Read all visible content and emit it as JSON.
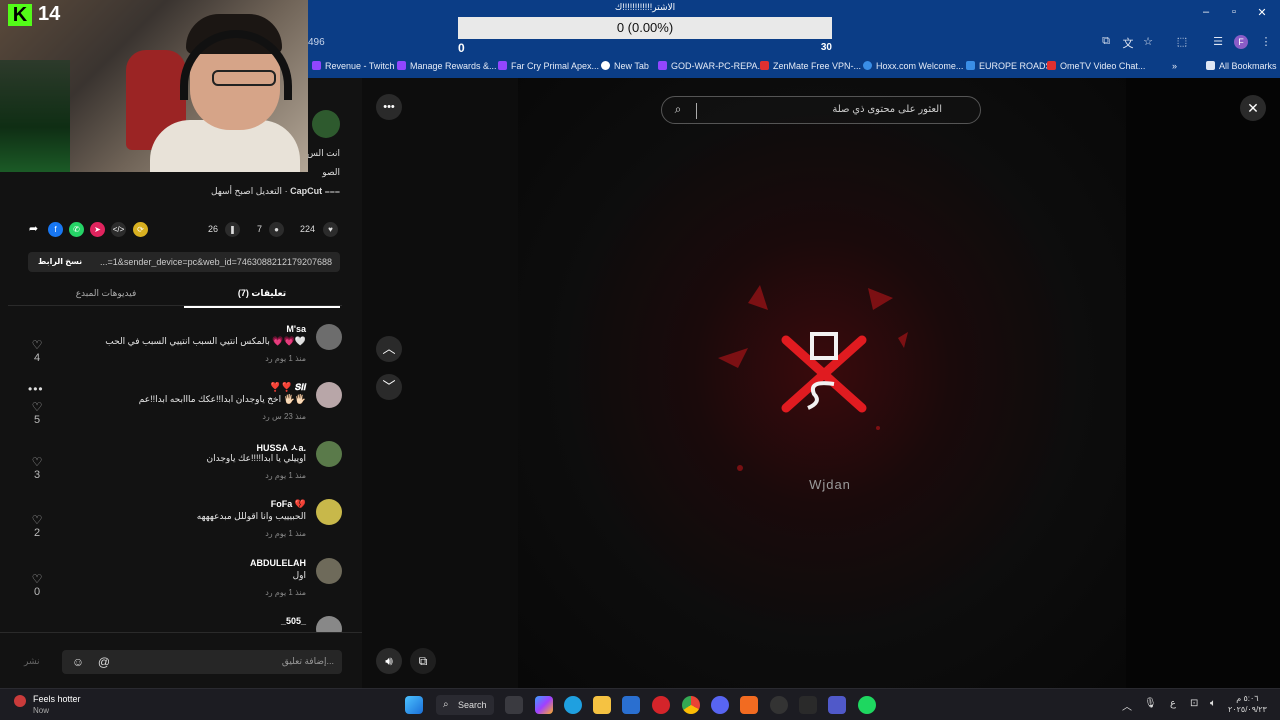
{
  "browser": {
    "url_fragment": "496",
    "window_controls": [
      "–",
      "▫",
      "✕"
    ],
    "bookmarks": [
      {
        "label": "Revenue - Twitch",
        "color": "#9146ff"
      },
      {
        "label": "Manage Rewards &...",
        "color": "#9146ff"
      },
      {
        "label": "Far Cry Primal Apex...",
        "color": "#9146ff"
      },
      {
        "label": "New Tab",
        "color": "#ffffff"
      },
      {
        "label": "GOD-WAR-PC-REPA...",
        "color": "#9146ff"
      },
      {
        "label": "ZenMate Free VPN-...",
        "color": "#e03030"
      },
      {
        "label": "Hoxx.com Welcome...",
        "color": "#3a8ee6"
      },
      {
        "label": "EUROPE ROADS",
        "color": "#3a8ee6"
      },
      {
        "label": "OmeTV Video Chat...",
        "color": "#e03030"
      },
      {
        "label": "All Bookmarks",
        "color": "#dfe6f3"
      }
    ],
    "profile_letter": "F"
  },
  "donation_goal": {
    "title": "الاشتر!!!!!!!!!!!!ك",
    "progress_text": "0 (0.00%)",
    "min": "0",
    "max": "30",
    "progress": 0
  },
  "stream_overlay": {
    "badge": "K",
    "count": "14"
  },
  "post": {
    "desc_line1": "انت الس",
    "desc_line2": "الصو",
    "capcut_label": "CapCut",
    "capcut_text": "التعديل اصبح أسهل ·",
    "likes": "224",
    "comments": "7",
    "saves": "26",
    "link_url": "...=1&sender_device=pc&web_id=7463088212179207688",
    "copy_link": "نسخ الرابط",
    "tab_comments": "(7) تعليقات",
    "tab_creator": "فيديوهات المبدع"
  },
  "comments": [
    {
      "user": "M'sa",
      "text": "بالمكس انتيي السبب انتييي السبب في الحب 💗💗🤍",
      "meta": "منذ 1 يوم    رد",
      "likes": "4",
      "avatar": "#6d6d6d"
    },
    {
      "user": "❣️❣️ 𝑺𝒊𝒊",
      "text": "اخخ ياوجدان ابدا!!عكك مااابحه ابدا!!عم 🖐🏻🖐🏻",
      "meta": "منذ 23 س    رد",
      "likes": "5",
      "avatar": "#b8a6a8"
    },
    {
      "user": "HUSSA ㅅa.",
      "text": "اوييلي يا ابدا!!!!عك ياوجدان",
      "meta": "منذ 1 يوم    رد",
      "likes": "3",
      "avatar": "#5a7a4a"
    },
    {
      "user": "FoFa 💔",
      "text": "الحبيييب وانا اقوللل مبدعهههه",
      "meta": "منذ 1 يوم    رد",
      "likes": "2",
      "avatar": "#c8b84a"
    },
    {
      "user": "ABDULELAH",
      "text": "اول",
      "meta": "منذ 1 يوم    رد",
      "likes": "0",
      "avatar": "#6e6a5a"
    },
    {
      "user": "_505_",
      "text": "",
      "meta": "",
      "likes": "",
      "avatar": "#888888"
    }
  ],
  "comment_input": {
    "placeholder": "إضافة تعليق...",
    "post_label": "نشر"
  },
  "video": {
    "search_placeholder": "العثور على محتوى ذي صلة",
    "creator_name": "Wjdan"
  },
  "taskbar": {
    "notif_title": "Feels hotter",
    "notif_sub": "Now",
    "search_label": "Search",
    "clock_time": "٥:٠٦ م",
    "clock_date": "٢٠٢٥/٠٩/٢٣",
    "lang": "ع"
  }
}
